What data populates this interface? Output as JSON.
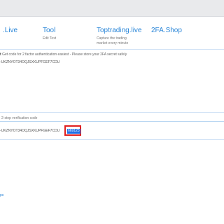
{
  "nav": [
    {
      "title": ".Live",
      "subtitle": ""
    },
    {
      "title": "Tool",
      "subtitle": "Edit Text"
    },
    {
      "title": "Toptrading.live",
      "subtitle_lines": [
        "Capture the trading",
        "market every minute"
      ]
    },
    {
      "title": "2FA.Shop",
      "subtitle": ""
    }
  ],
  "info": {
    "prefix": "t",
    "text": "Get code for 2 factor authentication easiest - Please store your 2FA secret safely"
  },
  "secret_input": {
    "value": "-UKZNYOT34OQJSXKUPFGEF7CDU"
  },
  "verification": {
    "label": "2-step verification code",
    "secret": "-UKZNYOT34OQJSXKUPFGEF7CDU",
    "code": "669123"
  },
  "bottom_link": "ps",
  "colors": {
    "link": "#2a86d8",
    "highlight_border": "#e01f1f",
    "code_background": "#1e6ee6"
  }
}
